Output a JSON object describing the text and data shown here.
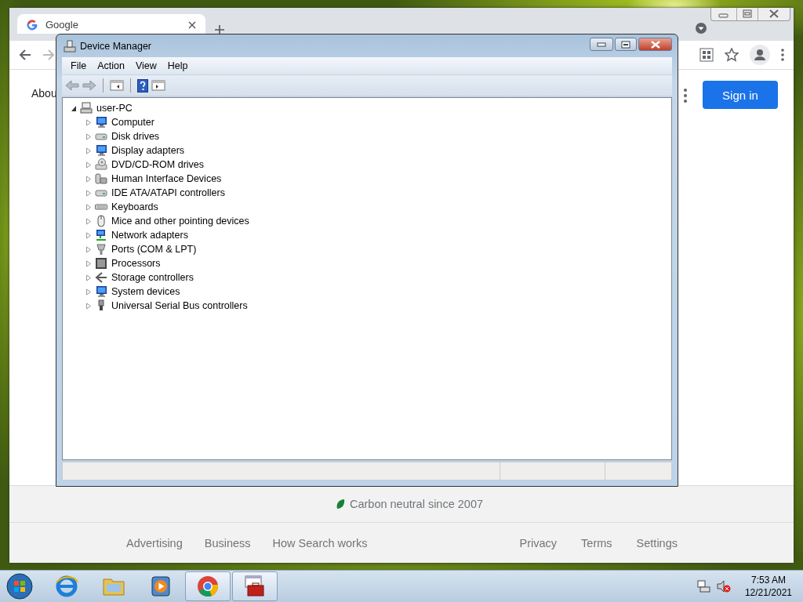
{
  "browser": {
    "tab": {
      "title": "Google"
    },
    "page": {
      "header_link": "Abou",
      "sign_in": "Sign in",
      "footer": {
        "carbon": "Carbon neutral since 2007",
        "links_left": [
          "Advertising",
          "Business",
          "How Search works"
        ],
        "links_right": [
          "Privacy",
          "Terms",
          "Settings"
        ]
      }
    }
  },
  "device_manager": {
    "title": "Device Manager",
    "menu": [
      "File",
      "Action",
      "View",
      "Help"
    ],
    "tree": {
      "label": "user-PC",
      "expanded": true,
      "children": [
        {
          "label": "Computer",
          "expanded": false
        },
        {
          "label": "Disk drives",
          "expanded": false
        },
        {
          "label": "Display adapters",
          "expanded": false
        },
        {
          "label": "DVD/CD-ROM drives",
          "expanded": false
        },
        {
          "label": "Human Interface Devices",
          "expanded": false
        },
        {
          "label": "IDE ATA/ATAPI controllers",
          "expanded": false
        },
        {
          "label": "Keyboards",
          "expanded": false
        },
        {
          "label": "Mice and other pointing devices",
          "expanded": false
        },
        {
          "label": "Network adapters",
          "expanded": false
        },
        {
          "label": "Ports (COM & LPT)",
          "expanded": false
        },
        {
          "label": "Processors",
          "expanded": false
        },
        {
          "label": "Storage controllers",
          "expanded": false
        },
        {
          "label": "System devices",
          "expanded": false
        },
        {
          "label": "Universal Serial Bus controllers",
          "expanded": false
        }
      ]
    }
  },
  "taskbar": {
    "apps": [
      {
        "selected": false
      },
      {
        "selected": false
      },
      {
        "selected": false
      },
      {
        "selected": true
      },
      {
        "selected": true
      }
    ],
    "clock": {
      "time": "7:53 AM",
      "date": "12/21/2021"
    }
  }
}
